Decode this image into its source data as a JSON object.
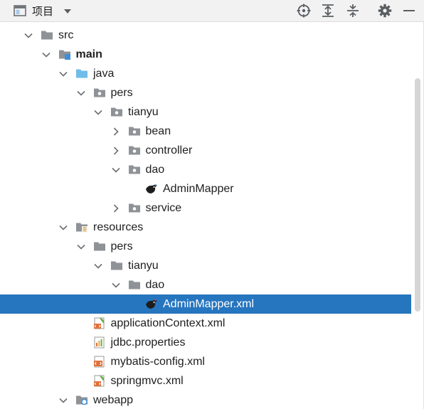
{
  "toolbar": {
    "title": "项目",
    "icons": [
      "project-view-icon",
      "dropdown-caret-icon",
      "locate-icon",
      "expand-all-icon",
      "collapse-all-icon",
      "settings-gear-icon",
      "minimize-icon"
    ]
  },
  "tree": {
    "items": [
      {
        "label": "src",
        "level": 1,
        "expanded": true,
        "icon": "folder-icon"
      },
      {
        "label": "main",
        "level": 2,
        "expanded": true,
        "icon": "module-folder-icon",
        "bold": true
      },
      {
        "label": "java",
        "level": 3,
        "expanded": true,
        "icon": "source-root-folder-icon"
      },
      {
        "label": "pers",
        "level": 4,
        "expanded": true,
        "icon": "package-icon"
      },
      {
        "label": "tianyu",
        "level": 5,
        "expanded": true,
        "icon": "package-icon"
      },
      {
        "label": "bean",
        "level": 6,
        "expanded": false,
        "icon": "package-icon"
      },
      {
        "label": "controller",
        "level": 6,
        "expanded": false,
        "icon": "package-icon"
      },
      {
        "label": "dao",
        "level": 6,
        "expanded": true,
        "icon": "package-icon"
      },
      {
        "label": "AdminMapper",
        "level": 7,
        "expanded": null,
        "icon": "mybatis-bird-icon"
      },
      {
        "label": "service",
        "level": 6,
        "expanded": false,
        "icon": "package-icon"
      },
      {
        "label": "resources",
        "level": 3,
        "expanded": true,
        "icon": "resources-root-folder-icon"
      },
      {
        "label": "pers",
        "level": 4,
        "expanded": true,
        "icon": "folder-icon"
      },
      {
        "label": "tianyu",
        "level": 5,
        "expanded": true,
        "icon": "folder-icon"
      },
      {
        "label": "dao",
        "level": 6,
        "expanded": true,
        "icon": "folder-icon"
      },
      {
        "label": "AdminMapper.xml",
        "level": 7,
        "expanded": null,
        "icon": "mybatis-xml-icon",
        "selected": true
      },
      {
        "label": "applicationContext.xml",
        "level": 4,
        "expanded": null,
        "icon": "spring-xml-icon"
      },
      {
        "label": "jdbc.properties",
        "level": 4,
        "expanded": null,
        "icon": "properties-file-icon"
      },
      {
        "label": "mybatis-config.xml",
        "level": 4,
        "expanded": null,
        "icon": "xml-file-icon"
      },
      {
        "label": "springmvc.xml",
        "level": 4,
        "expanded": null,
        "icon": "spring-xml-icon"
      },
      {
        "label": "webapp",
        "level": 3,
        "expanded": true,
        "icon": "web-folder-icon"
      }
    ]
  },
  "colors": {
    "selection": "#2675bf",
    "folder": "#8f9296",
    "source_root": "#6fbde8",
    "module_badge": "#3e8fd8",
    "spring_green": "#6bad45",
    "xml_orange": "#e0703a"
  }
}
